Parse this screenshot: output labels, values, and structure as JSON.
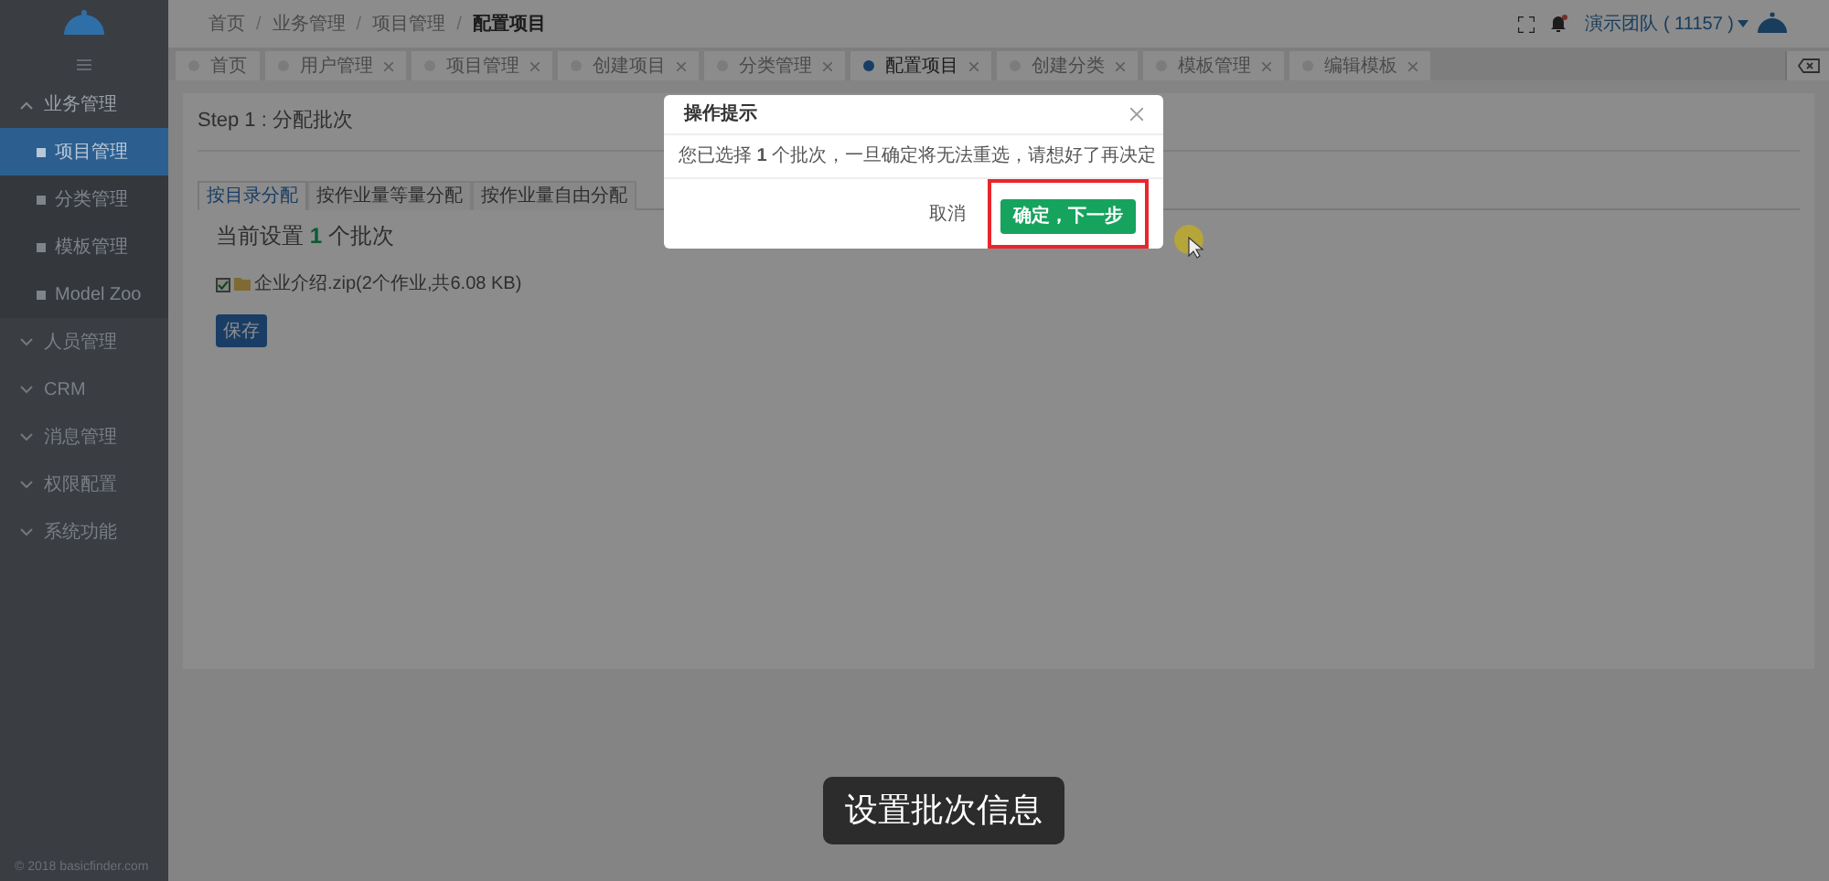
{
  "sidebar": {
    "groups": [
      {
        "label": "业务管理",
        "expanded": true,
        "children": [
          {
            "label": "项目管理",
            "selected": true
          },
          {
            "label": "分类管理",
            "selected": false
          },
          {
            "label": "模板管理",
            "selected": false
          },
          {
            "label": "Model Zoo",
            "selected": false
          }
        ]
      },
      {
        "label": "人员管理",
        "expanded": false
      },
      {
        "label": "CRM",
        "expanded": false
      },
      {
        "label": "消息管理",
        "expanded": false
      },
      {
        "label": "权限配置",
        "expanded": false
      },
      {
        "label": "系统功能",
        "expanded": false
      }
    ],
    "footer": "© 2018 basicfinder.com"
  },
  "header": {
    "separator": "/",
    "breadcrumbs": [
      "首页",
      "业务管理",
      "项目管理",
      "配置项目"
    ],
    "has_notification": true,
    "user": "演示团队 ( 11157 )"
  },
  "tabs": [
    {
      "label": "首页",
      "selected": false,
      "closable": false
    },
    {
      "label": "用户管理",
      "selected": false,
      "closable": true
    },
    {
      "label": "项目管理",
      "selected": false,
      "closable": true
    },
    {
      "label": "创建项目",
      "selected": false,
      "closable": true
    },
    {
      "label": "分类管理",
      "selected": false,
      "closable": true
    },
    {
      "label": "配置项目",
      "selected": true,
      "closable": true
    },
    {
      "label": "创建分类",
      "selected": false,
      "closable": true
    },
    {
      "label": "模板管理",
      "selected": false,
      "closable": true
    },
    {
      "label": "编辑模板",
      "selected": false,
      "closable": true
    }
  ],
  "content": {
    "step_title": "Step 1 : 分配批次",
    "sub_tabs": [
      {
        "label": "按目录分配",
        "selected": true
      },
      {
        "label": "按作业量等量分配",
        "selected": false
      },
      {
        "label": "按作业量自由分配",
        "selected": false
      }
    ],
    "current_setting": "当前设置 **1** 个批次",
    "files": [
      {
        "label": "企业介绍.zip(2个作业,共6.08 KB)",
        "checked": true
      }
    ],
    "save_button": "保存"
  },
  "modal": {
    "title": "操作提示",
    "message": "您已选择 **1** 个批次，一旦确定将无法重选，请想好了再决定",
    "cancel": "取消",
    "confirm": "确定，下一步",
    "confirm_highlighted": true
  },
  "caption": "设置批次信息"
}
